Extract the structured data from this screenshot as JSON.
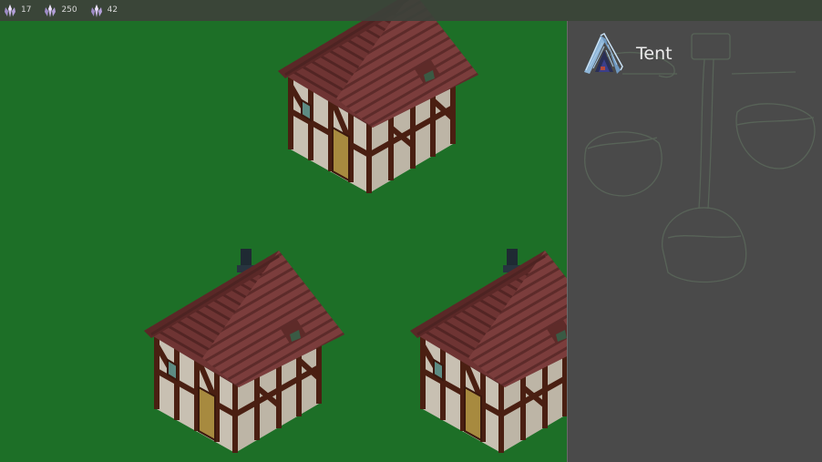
{
  "resources": [
    {
      "icon": "crystal-icon",
      "value": "17"
    },
    {
      "icon": "crystal-icon",
      "value": "250"
    },
    {
      "icon": "crystal-icon",
      "value": "42"
    }
  ],
  "build_panel": {
    "items": [
      {
        "icon": "tent-icon",
        "label": "Tent"
      }
    ]
  },
  "colors": {
    "grass": "#1d6f27",
    "roof": "#7a3b3a",
    "timber": "#4a1f12",
    "plaster": "#c9c2b4",
    "panel_bg": "#4a4a4a",
    "topbar_bg": "#3c423a"
  }
}
